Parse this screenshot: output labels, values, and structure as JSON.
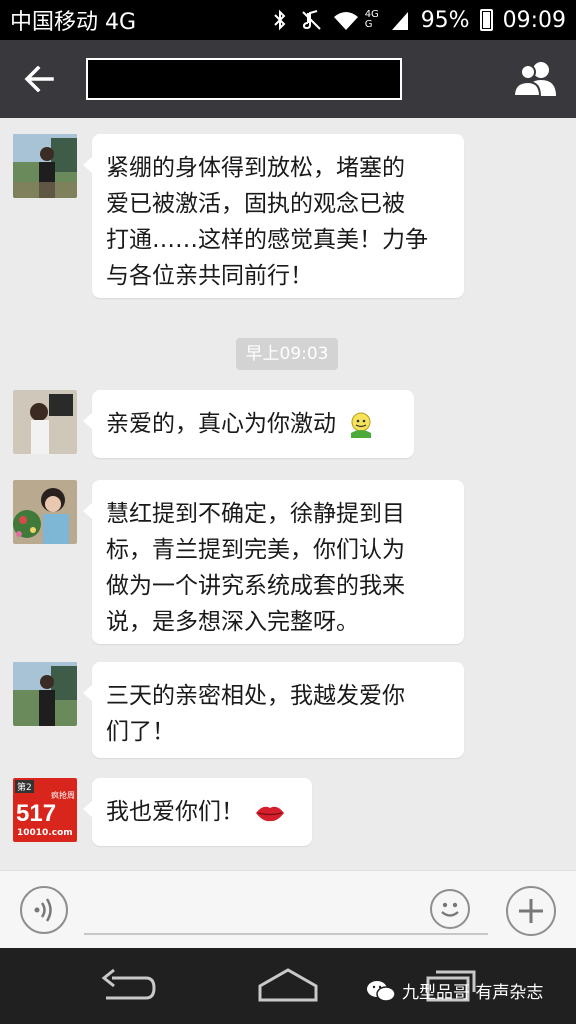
{
  "status_bar": {
    "carrier": "中国移动 4G",
    "network_label_top": "4G",
    "network_label_bottom": "G",
    "battery": "95%",
    "time": "09:09"
  },
  "header": {
    "title": "",
    "back_icon": "arrow-left-icon",
    "contacts_icon": "group-icon"
  },
  "chat": {
    "timestamp": "早上09:03",
    "messages": [
      {
        "text_lines": [
          "紧绷的身体得到放松，堵塞的",
          "爱已被激活，固执的观念已被",
          "打通……这样的感觉真美！力争",
          "与各位亲共同前行！"
        ]
      },
      {
        "text": "亲爱的，真心为你激动",
        "emoji": "smiley-emoji"
      },
      {
        "text_lines": [
          "慧红提到不确定，徐静提到目",
          "标，青兰提到完美，你们认为",
          "做为一个讲究系统成套的我来",
          "说，是多想深入完整呀。"
        ]
      },
      {
        "text_lines": [
          "三天的亲密相处，我越发爱你",
          "们了！"
        ]
      },
      {
        "text": "我也爱你们！",
        "emoji": "lips-emoji"
      }
    ],
    "avatar4_text": {
      "badge": "第2",
      "top_right": "疯抢周",
      "number": "517",
      "site": "10010.com"
    }
  },
  "input_bar": {
    "placeholder": ""
  },
  "watermark": {
    "text": "九型品哥 有声杂志"
  },
  "colors": {
    "header_bg": "#39393d",
    "chat_bg": "#ebebeb",
    "bubble_bg": "#ffffff",
    "timestamp_bg": "#d3d3d3"
  }
}
